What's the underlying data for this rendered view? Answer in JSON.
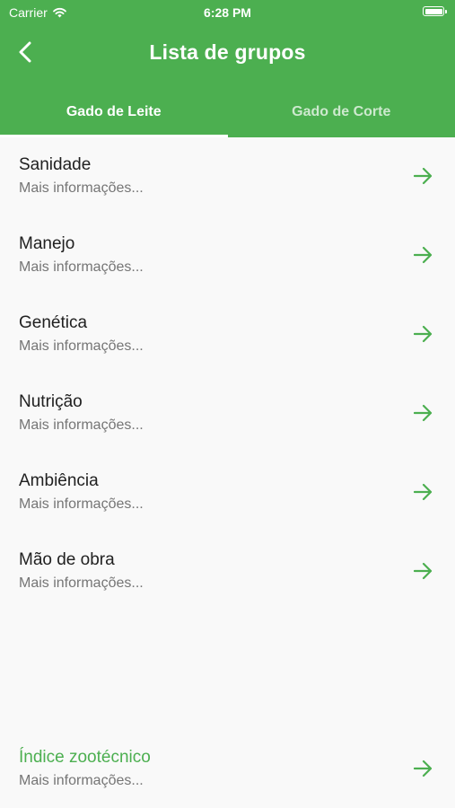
{
  "status_bar": {
    "carrier": "Carrier",
    "time": "6:28 PM"
  },
  "appbar": {
    "title": "Lista de grupos",
    "back_icon": "chevron-left-icon"
  },
  "tabs": [
    {
      "label": "Gado de Leite",
      "active": true
    },
    {
      "label": "Gado de Corte",
      "active": false
    }
  ],
  "groups": [
    {
      "title": "Sanidade",
      "subtitle": "Mais informações..."
    },
    {
      "title": "Manejo",
      "subtitle": "Mais informações..."
    },
    {
      "title": "Genética",
      "subtitle": "Mais informações..."
    },
    {
      "title": "Nutrição",
      "subtitle": "Mais informações..."
    },
    {
      "title": "Ambiência",
      "subtitle": "Mais informações..."
    },
    {
      "title": "Mão de obra",
      "subtitle": "Mais informações..."
    }
  ],
  "footer_item": {
    "title": "Índice zootécnico",
    "subtitle": "Mais informações..."
  },
  "colors": {
    "primary": "#4caf50",
    "title_text": "#212121",
    "subtitle_text": "#757575",
    "background": "#f9f9f9"
  },
  "icons": {
    "arrow": "arrow-right-icon",
    "wifi": "wifi-icon",
    "battery": "battery-icon"
  }
}
